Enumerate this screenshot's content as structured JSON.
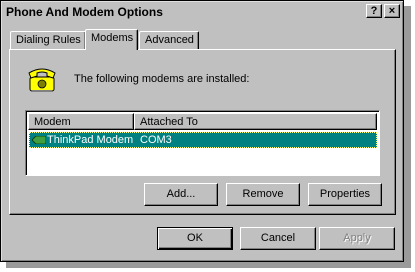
{
  "window": {
    "title": "Phone And Modem Options",
    "help_glyph": "?",
    "close_glyph": "×"
  },
  "tabs": [
    {
      "label": "Dialing Rules",
      "selected": false
    },
    {
      "label": "Modems",
      "selected": true
    },
    {
      "label": "Advanced",
      "selected": false
    }
  ],
  "modems_panel": {
    "intro_text": "The following modems are  installed:",
    "icon": "telephone-icon",
    "columns": [
      "Modem",
      "Attached To"
    ],
    "rows": [
      {
        "modem": "ThinkPad Modem",
        "port": "COM3",
        "icon": "modem-icon",
        "selected": true
      }
    ]
  },
  "panel_buttons": {
    "add": "Add...",
    "remove": "Remove",
    "properties": "Properties"
  },
  "dialog_buttons": {
    "ok": "OK",
    "cancel": "Cancel",
    "apply": "Apply"
  },
  "colors": {
    "face": "#c0c0c0",
    "selection": "#008080"
  }
}
